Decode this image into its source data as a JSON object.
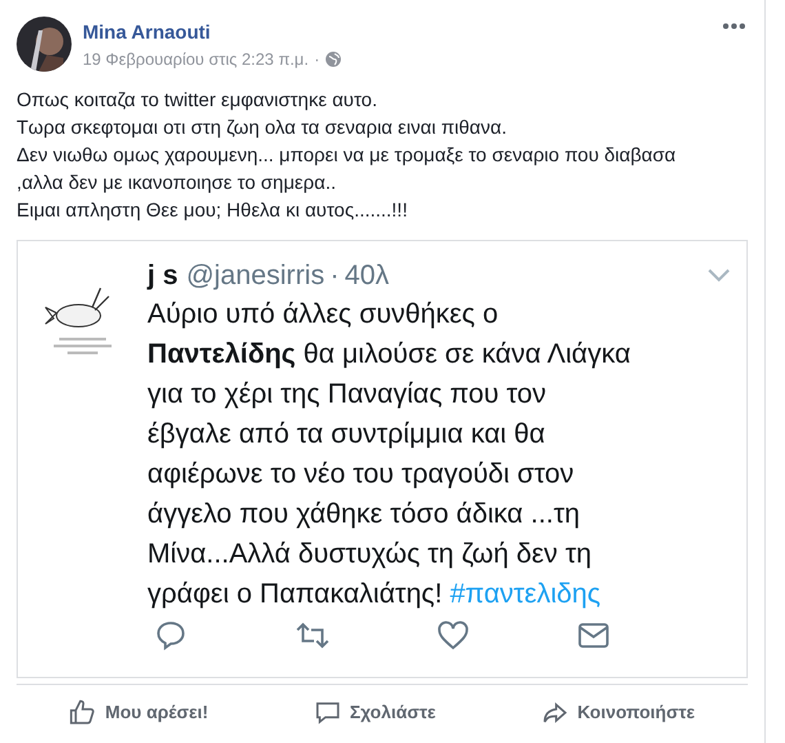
{
  "post": {
    "author": "Mina Arnaouti",
    "timestamp": "19 Φεβρουαρίου στις 2:23 π.μ.",
    "separator": "·",
    "body": [
      "Οπως κοιταζα το twitter εμφανιστηκε αυτο.",
      "Τωρα σκεφτομαι οτι στη ζωη ολα τα σεναρια ειναι πιθανα.",
      "Δεν νιωθω ομως χαρουμενη... μπορει να με τρομαξε το σεναριο που διαβασα",
      ",αλλα δεν με ικανοποιησε το σημερα..",
      "Ειμαι απληστη Θεε μου; Ηθελα κι αυτος.......!!!"
    ]
  },
  "tweet": {
    "name": "j s",
    "handle": "@janesirris",
    "separator": "·",
    "age": "40λ",
    "lines": [
      [
        {
          "kind": "plain",
          "text": "Αύριο υπό άλλες συνθήκες ο"
        }
      ],
      [
        {
          "kind": "bold",
          "text": "Παντελίδης"
        },
        {
          "kind": "plain",
          "text": " θα μιλούσε σε κάνα Λιάγκα"
        }
      ],
      [
        {
          "kind": "plain",
          "text": "για το χέρι της Παναγίας που τον"
        }
      ],
      [
        {
          "kind": "plain",
          "text": "έβγαλε από τα συντρίμμια και θα"
        }
      ],
      [
        {
          "kind": "plain",
          "text": "αφιέρωνε το νέο του τραγούδι στον"
        }
      ],
      [
        {
          "kind": "plain",
          "text": "άγγελο που χάθηκε τόσο άδικα ...τη"
        }
      ],
      [
        {
          "kind": "plain",
          "text": "Μίνα...Αλλά δυστυχώς τη ζωή δεν τη"
        }
      ],
      [
        {
          "kind": "plain",
          "text": "γράφει ο Παπακαλιάτης! "
        },
        {
          "kind": "hashtag",
          "text": "#παντελιδης"
        }
      ]
    ]
  },
  "actions": [
    {
      "kind": "like",
      "label": "Μου αρέσει!"
    },
    {
      "kind": "comment",
      "label": "Σχολιάστε"
    },
    {
      "kind": "share",
      "label": "Κοινοποιήστε"
    }
  ]
}
